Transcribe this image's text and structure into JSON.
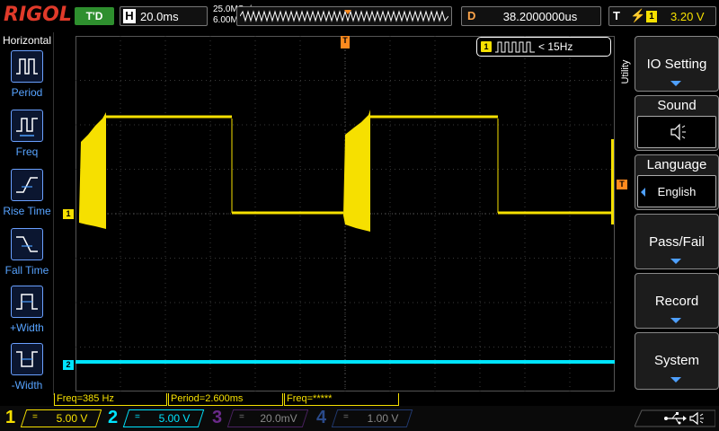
{
  "brand": "RIGOL",
  "top": {
    "trigger_state": "T'D",
    "horizontal_key": "H",
    "timebase": "20.0ms",
    "sample_rate": "25.0MSa/s",
    "memory_depth": "6.00M pts",
    "delay_key": "D",
    "delay": "38.2000000us",
    "trigger_key": "T",
    "trigger_source": "1",
    "trigger_level": "3.20 V"
  },
  "left_menu": {
    "title": "Horizontal",
    "items": [
      {
        "label": "Period",
        "icon": "period-icon"
      },
      {
        "label": "Freq",
        "icon": "freq-icon"
      },
      {
        "label": "Rise Time",
        "icon": "rise-time-icon"
      },
      {
        "label": "Fall Time",
        "icon": "fall-time-icon"
      },
      {
        "label": "+Width",
        "icon": "positive-width-icon"
      },
      {
        "label": "-Width",
        "icon": "negative-width-icon"
      }
    ]
  },
  "freq_counter": {
    "channel": "1",
    "text": "< 15Hz"
  },
  "markers": {
    "ch1": "1",
    "ch2": "2",
    "trigger_pos": "T",
    "trigger_level": "T"
  },
  "right_menu": {
    "tab": "Utility",
    "io_setting": "IO Setting",
    "sound": "Sound",
    "sound_icon": "speaker-icon",
    "language": "Language",
    "language_value": "English",
    "pass_fail": "Pass/Fail",
    "record": "Record",
    "system": "System"
  },
  "measurements": [
    "Freq=385 Hz",
    "Period=2.600ms",
    "Freq=*****"
  ],
  "channels": [
    {
      "num": "1",
      "coupling": "=",
      "scale": "5.00 V",
      "color": "#f6e000",
      "active": true
    },
    {
      "num": "2",
      "coupling": "=",
      "scale": "5.00 V",
      "color": "#00e5ff",
      "active": true
    },
    {
      "num": "3",
      "coupling": "=",
      "scale": "20.0mV",
      "color": "#c04dff",
      "active": false
    },
    {
      "num": "4",
      "coupling": "=",
      "scale": "1.00 V",
      "color": "#3a7bff",
      "active": false
    }
  ],
  "status_icons": [
    "usb-icon",
    "speaker-icon"
  ],
  "colors": {
    "ch1": "#f6e000",
    "ch2": "#00e5ff",
    "accent": "#4ea0ff",
    "trigger": "#ff8a1e"
  }
}
